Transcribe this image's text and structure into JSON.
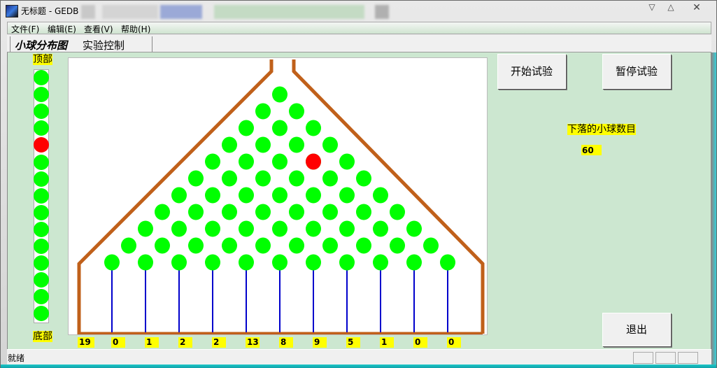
{
  "window": {
    "title": "无标题 - GEDB",
    "controls": {
      "minimize": "▽",
      "maximize": "△",
      "close": "✕"
    }
  },
  "menu": {
    "items": [
      {
        "label": "文件(F)"
      },
      {
        "label": "编辑(E)"
      },
      {
        "label": "查看(V)"
      },
      {
        "label": "帮助(H)"
      }
    ]
  },
  "tabs": [
    {
      "label": "小球分布图",
      "active": true
    },
    {
      "label": "实验控制",
      "active": false
    }
  ],
  "column": {
    "top_label": "顶部",
    "bottom_label": "底部",
    "ball_count": 15,
    "red_ball_index": 4
  },
  "board": {
    "rows": 11,
    "moving_ball": {
      "row": 4,
      "slot": 6
    },
    "colors": {
      "peg": "#00ff00",
      "active_ball": "#ff0000",
      "wall": "#c0601a",
      "divider": "#0000cc"
    }
  },
  "bins": {
    "counts": [
      "19",
      "0",
      "1",
      "2",
      "2",
      "13",
      "8",
      "9",
      "5",
      "1",
      "0",
      "0"
    ]
  },
  "controls": {
    "start_button": "开始试验",
    "pause_button": "暂停试验",
    "exit_button": "退出",
    "fallen_label": "下落的小球数目",
    "fallen_value": "60"
  },
  "status": {
    "text": "就绪"
  }
}
